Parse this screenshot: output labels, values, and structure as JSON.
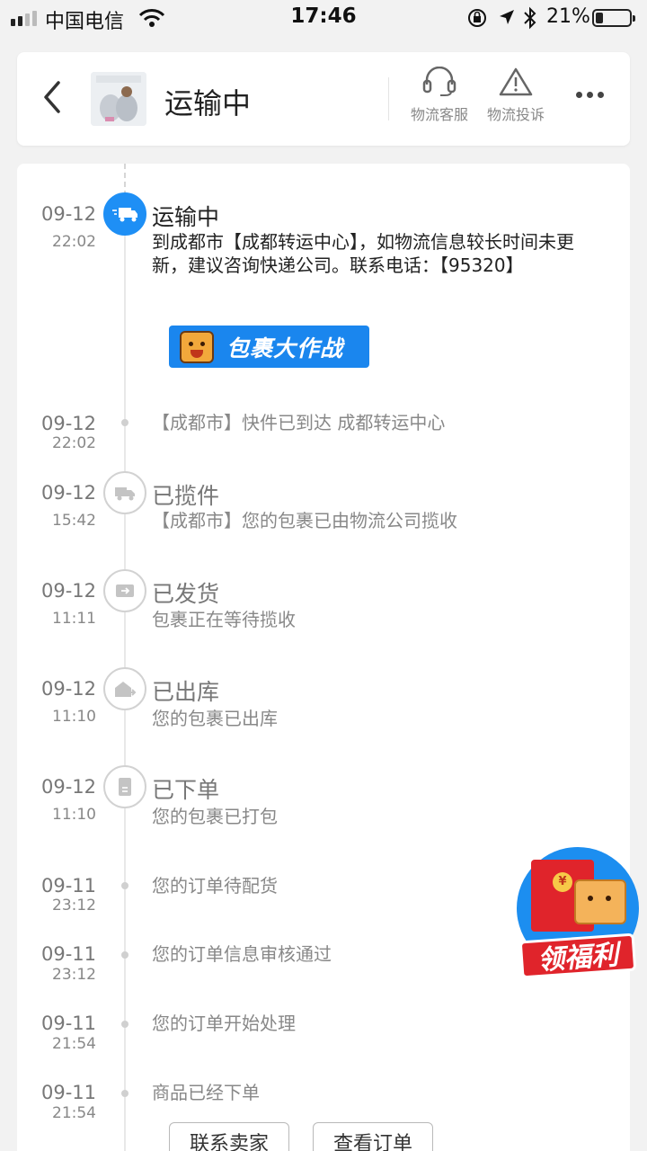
{
  "status_bar": {
    "carrier": "中国电信",
    "time": "17:46",
    "battery_percent": "21%",
    "battery_level": 0.21
  },
  "header": {
    "title": "运输中",
    "actions": [
      {
        "label": "物流客服",
        "icon": "headset-icon"
      },
      {
        "label": "物流投诉",
        "icon": "warning-icon"
      }
    ]
  },
  "banner": {
    "text": "包裹大作战"
  },
  "events": [
    {
      "date": "09-12",
      "time": "22:02",
      "status": "运输中",
      "desc": "到成都市【成都转运中心】，如物流信息较长时间未更新，建议咨询快递公司。联系电话：【95320】",
      "icon": "truck-icon",
      "active": true
    },
    {
      "date": "09-12",
      "time": "22:02",
      "status": "",
      "desc": "【成都市】快件已到达 成都转运中心",
      "icon": "dot"
    },
    {
      "date": "09-12",
      "time": "15:42",
      "status": "已揽件",
      "desc": "【成都市】您的包裹已由物流公司揽收",
      "icon": "pickup-truck-icon"
    },
    {
      "date": "09-12",
      "time": "11:11",
      "status": "已发货",
      "desc": "包裹正在等待揽收",
      "icon": "shipped-icon"
    },
    {
      "date": "09-12",
      "time": "11:10",
      "status": "已出库",
      "desc": "您的包裹已出库",
      "icon": "warehouse-icon"
    },
    {
      "date": "09-12",
      "time": "11:10",
      "status": "已下单",
      "desc": "您的包裹已打包",
      "icon": "document-icon"
    },
    {
      "date": "09-11",
      "time": "23:12",
      "status": "",
      "desc": "您的订单待配货",
      "icon": "dot"
    },
    {
      "date": "09-11",
      "time": "23:12",
      "status": "",
      "desc": "您的订单信息审核通过",
      "icon": "dot"
    },
    {
      "date": "09-11",
      "time": "21:54",
      "status": "",
      "desc": "您的订单开始处理",
      "icon": "dot"
    },
    {
      "date": "09-11",
      "time": "21:54",
      "status": "",
      "desc": "商品已经下单",
      "icon": "dot"
    }
  ],
  "promo": {
    "label": "领福利",
    "coin": "¥"
  },
  "buttons": {
    "contact_seller": "联系卖家",
    "view_order": "查看订单"
  },
  "colors": {
    "accent": "#1e8ff5",
    "promo_red": "#e0242b"
  }
}
